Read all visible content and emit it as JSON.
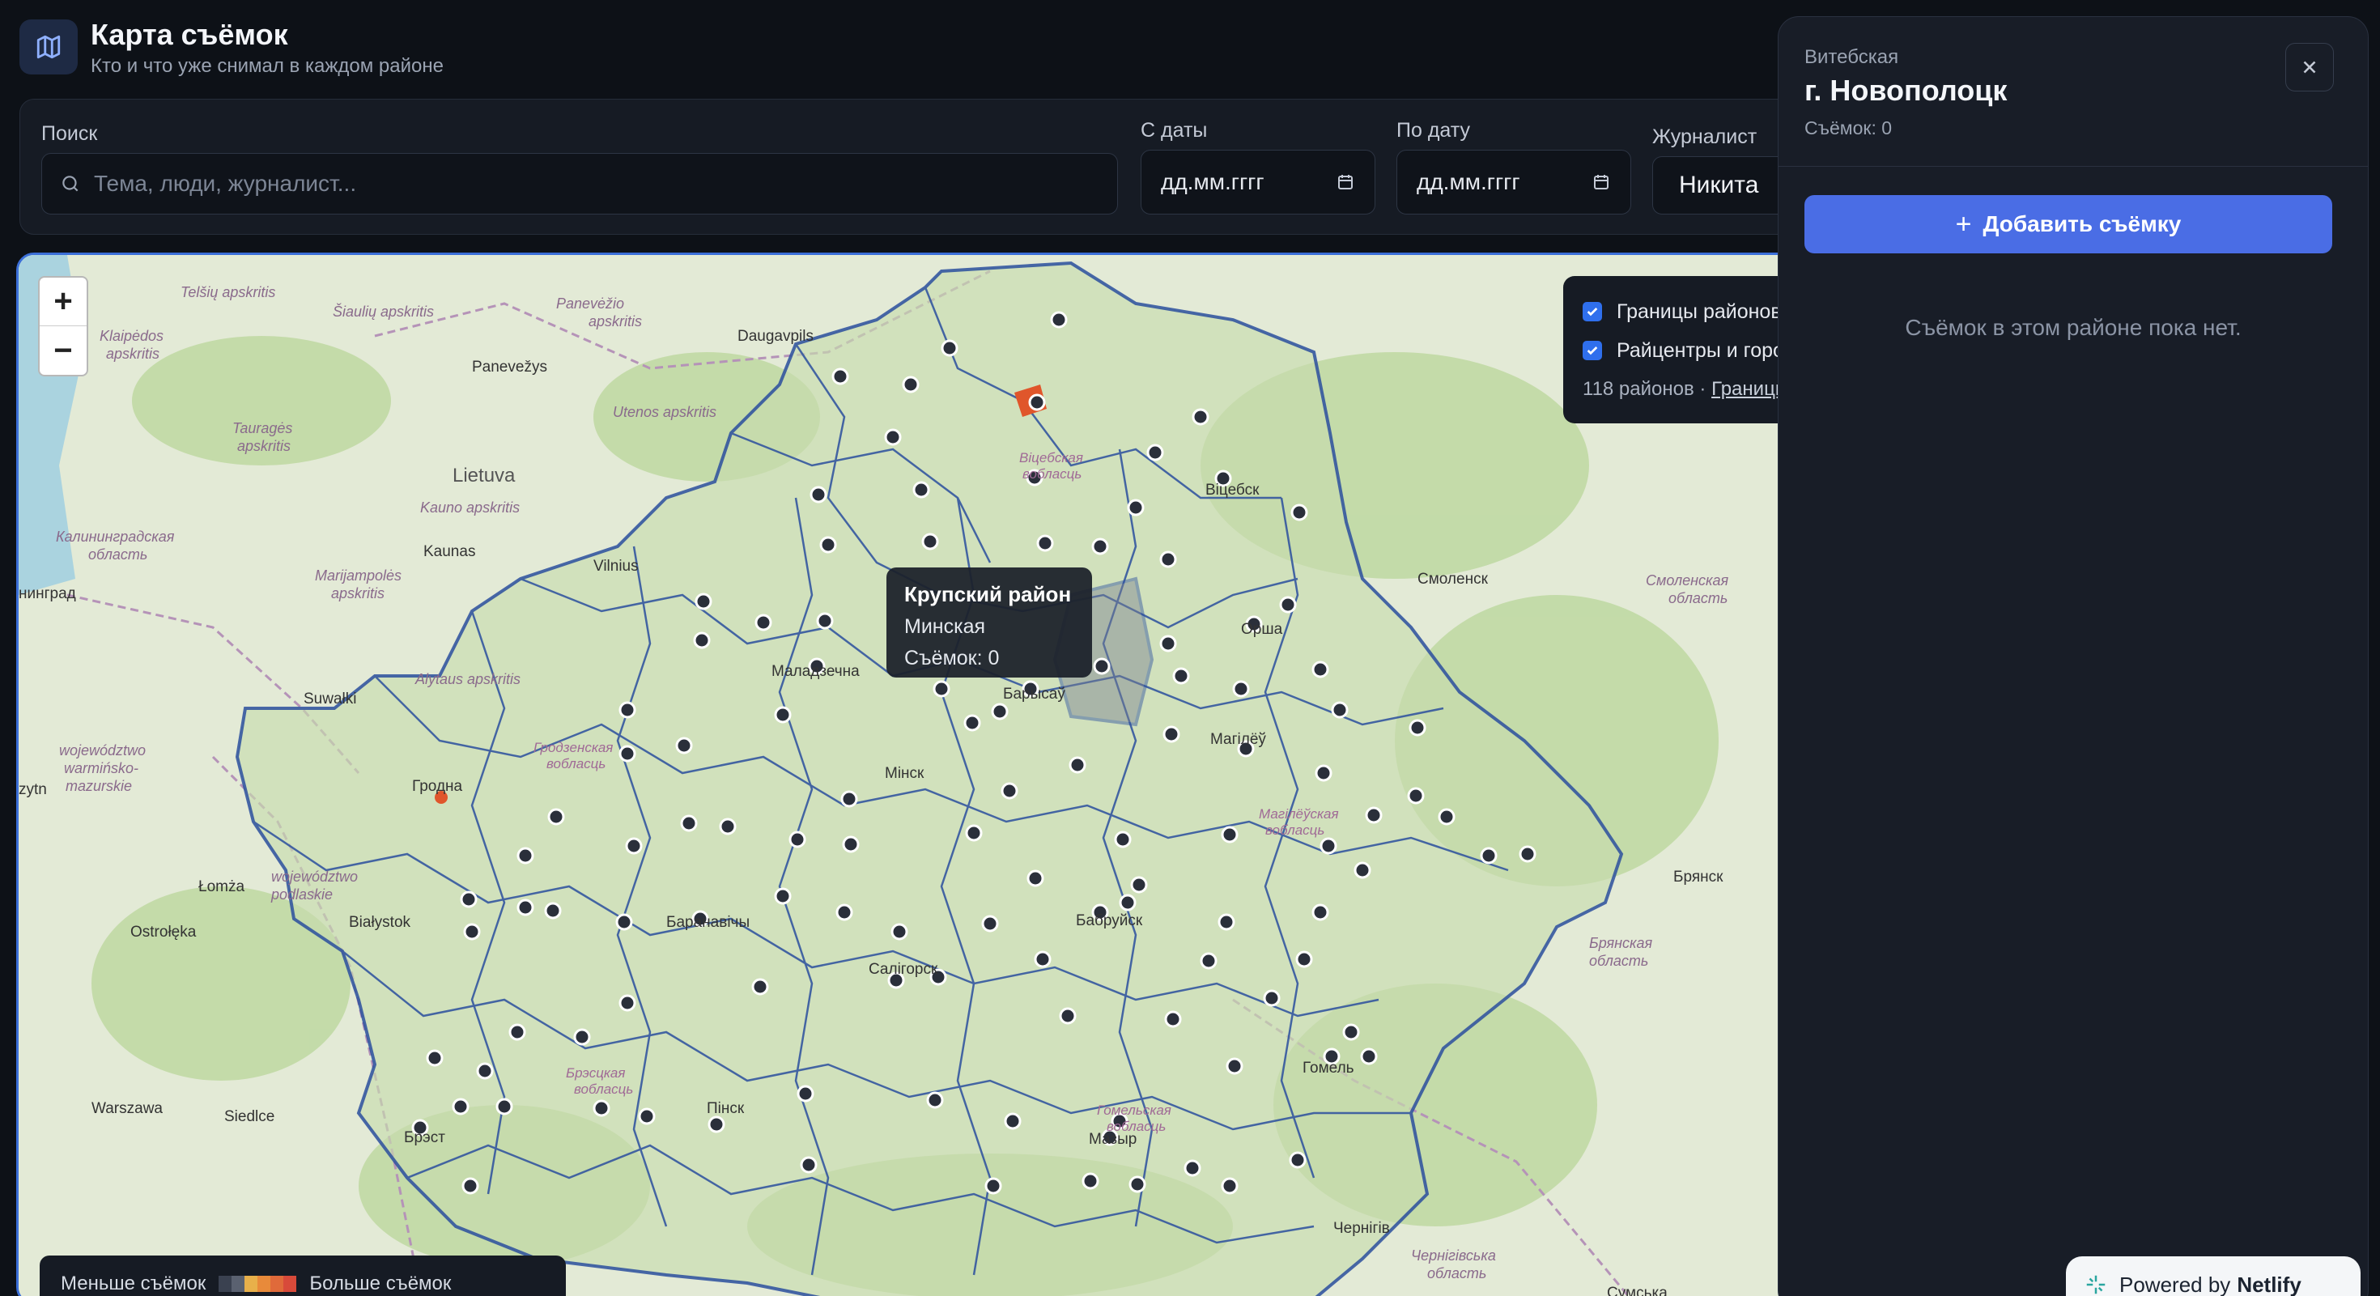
{
  "header": {
    "title": "Карта съёмок",
    "subtitle": "Кто и что уже снимал в каждом районе",
    "logo_icon": "map-icon"
  },
  "filters": {
    "search_label": "Поиск",
    "search_placeholder": "Тема, люди, журналист...",
    "from_label": "С даты",
    "from_value": "дд.мм.гггг",
    "to_label": "По дату",
    "to_value": "дд.мм.гггг",
    "journalist_label": "Журналист",
    "journalist_value": "Никита"
  },
  "map": {
    "zoom_in": "+",
    "zoom_out": "−",
    "layers": {
      "boundaries_label": "Границы районов",
      "boundaries_checked": true,
      "centers_label": "Райцентры и города",
      "centers_checked": true,
      "info_count": "118 районов · ",
      "info_link": "Границы"
    },
    "tooltip": {
      "title": "Крупский район",
      "region": "Минская",
      "count": "Съёмок: 0"
    },
    "legend": {
      "less": "Меньше съёмок",
      "more": "Больше съёмок",
      "ramp_colors": [
        "#3a4150",
        "#5a6170",
        "#e8b04a",
        "#e88a3a",
        "#e06a3a",
        "#d84a3a"
      ]
    },
    "place_labels": [
      "Telšių apskritis",
      "Šiaulių apskritis",
      "Panevėžio apskritis",
      "Daugavpils",
      "Klaipėdos apskritis",
      "Panevežys",
      "Utenos apskritis",
      "Tauragės apskritis",
      "Lietuva",
      "Kauno apskritis",
      "Kaunas",
      "Vilnius",
      "Калининградская область",
      "нинград",
      "Marijampolės apskritis",
      "Alytaus apskritis",
      "Suwałki",
      "Гродна",
      "Warszawa",
      "Siedlce",
      "Białystok",
      "Łomża",
      "Ostrołęka",
      "województwo podlaskie",
      "województwo warmińsko-mazurskie",
      "zytn",
      "Брэст",
      "Пінск",
      "Мінск",
      "Маладзечна",
      "Барысаў",
      "Віцебск",
      "Орша",
      "Магілёў",
      "Бабруйск",
      "Гомель",
      "Мазыр",
      "Салігорск",
      "Баранавічы",
      "Гомельская вобласць",
      "Брэсцкая вобласць",
      "Гродзенская вобласць",
      "Магілёўская вобласць",
      "Віцебская вобласць",
      "Смоленск",
      "Смоленская область",
      "Брянск",
      "Брянская область",
      "Чернігів",
      "Чернігівська область",
      "Сумська"
    ]
  },
  "panel": {
    "region": "Витебская",
    "title": "г. Новополоцк",
    "count": "Съёмок: 0",
    "add_label": "Добавить съёмку",
    "empty_text": "Съёмок в этом районе пока нет.",
    "close_icon": "close-icon"
  },
  "footer": {
    "powered": "Powered by",
    "brand": "Netlify"
  },
  "colors": {
    "accent": "#4a6de5",
    "boundary": "#2b4f9e",
    "hot": "#e0562b"
  }
}
